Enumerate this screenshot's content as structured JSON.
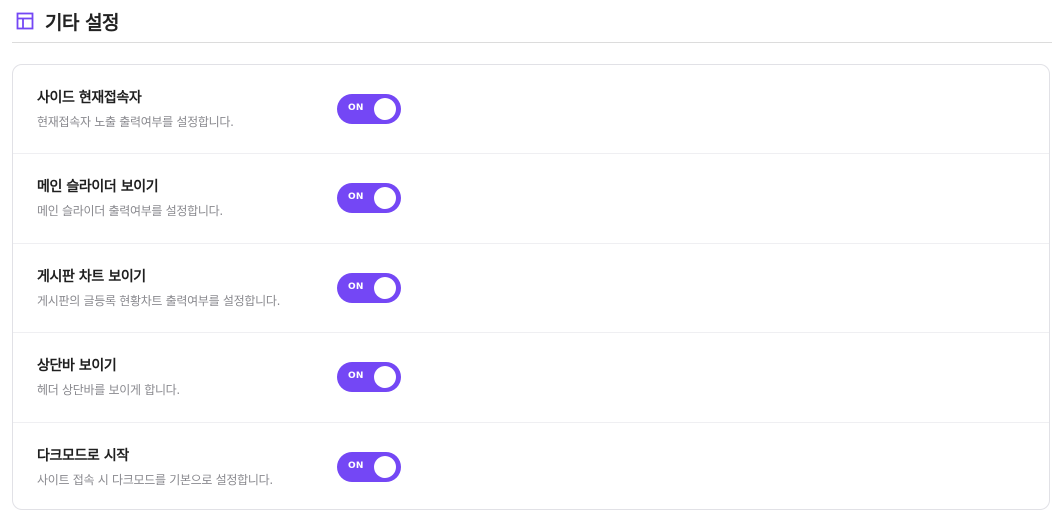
{
  "header": {
    "title": "기타 설정",
    "icon": "layout-icon",
    "accent_color": "#7447f5"
  },
  "settings": [
    {
      "title": "사이드 현재접속자",
      "description": "현재접속자 노출 출력여부를 설정합니다.",
      "toggle_label": "ON",
      "enabled": true
    },
    {
      "title": "메인 슬라이더 보이기",
      "description": "메인 슬라이더 출력여부를 설정합니다.",
      "toggle_label": "ON",
      "enabled": true
    },
    {
      "title": "게시판 차트 보이기",
      "description": "게시판의 글등록 현황차트 출력여부를 설정합니다.",
      "toggle_label": "ON",
      "enabled": true
    },
    {
      "title": "상단바 보이기",
      "description": "헤더 상단바를 보이게 합니다.",
      "toggle_label": "ON",
      "enabled": true
    },
    {
      "title": "다크모드로 시작",
      "description": "사이트 접속 시 다크모드를 기본으로 설정합니다.",
      "toggle_label": "ON",
      "enabled": true
    }
  ]
}
